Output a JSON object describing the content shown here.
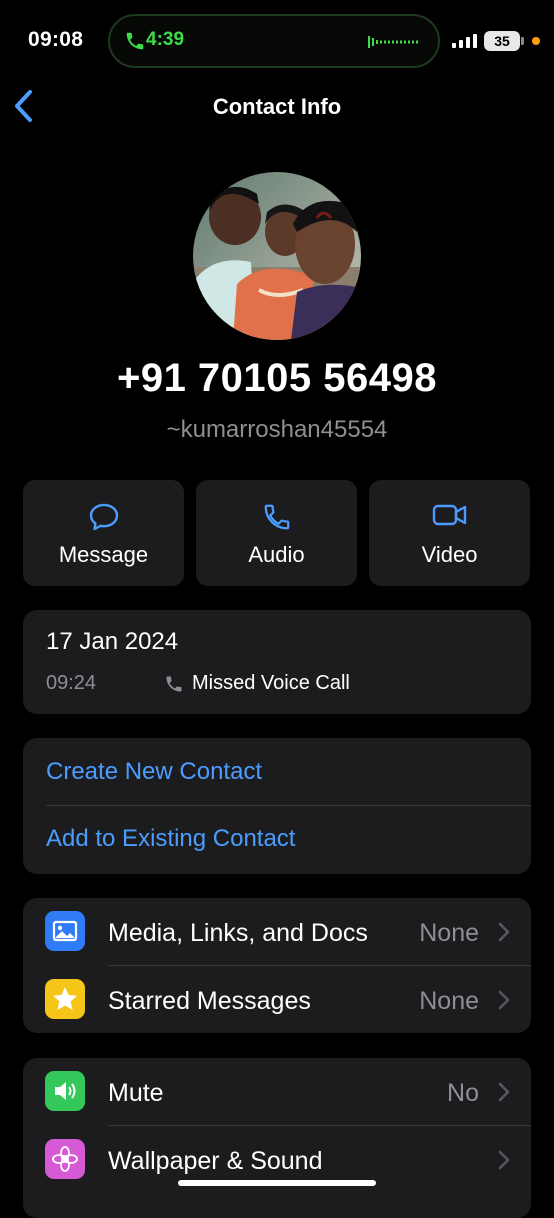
{
  "status_bar": {
    "time": "09:08",
    "call_timer": "4:39",
    "battery": "35",
    "accent_green": "#3ddc4c",
    "privacy_dot_color": "#ff9f0a"
  },
  "nav": {
    "title": "Contact Info",
    "back_icon": "chevron-left-icon"
  },
  "profile": {
    "phone": "+91 70105 56498",
    "username": "~kumarroshan45554"
  },
  "actions": [
    {
      "label": "Message",
      "icon": "message-bubble-icon"
    },
    {
      "label": "Audio",
      "icon": "phone-icon"
    },
    {
      "label": "Video",
      "icon": "video-camera-icon"
    }
  ],
  "call_log": {
    "date": "17 Jan 2024",
    "time": "09:24",
    "status": "Missed Voice Call"
  },
  "contact_options": {
    "create": "Create New Contact",
    "add_existing": "Add to Existing Contact",
    "link_color": "#4a9dff"
  },
  "media_section": [
    {
      "label": "Media, Links, and Docs",
      "value": "None",
      "icon": "photo-icon",
      "color": "#2f7cf6"
    },
    {
      "label": "Starred Messages",
      "value": "None",
      "icon": "star-icon",
      "color": "#f5c518"
    }
  ],
  "settings_section": [
    {
      "label": "Mute",
      "value": "No",
      "icon": "speaker-icon",
      "color": "#34c759"
    },
    {
      "label": "Wallpaper & Sound",
      "value": "",
      "icon": "flower-icon",
      "color": "#d65ad6"
    }
  ]
}
